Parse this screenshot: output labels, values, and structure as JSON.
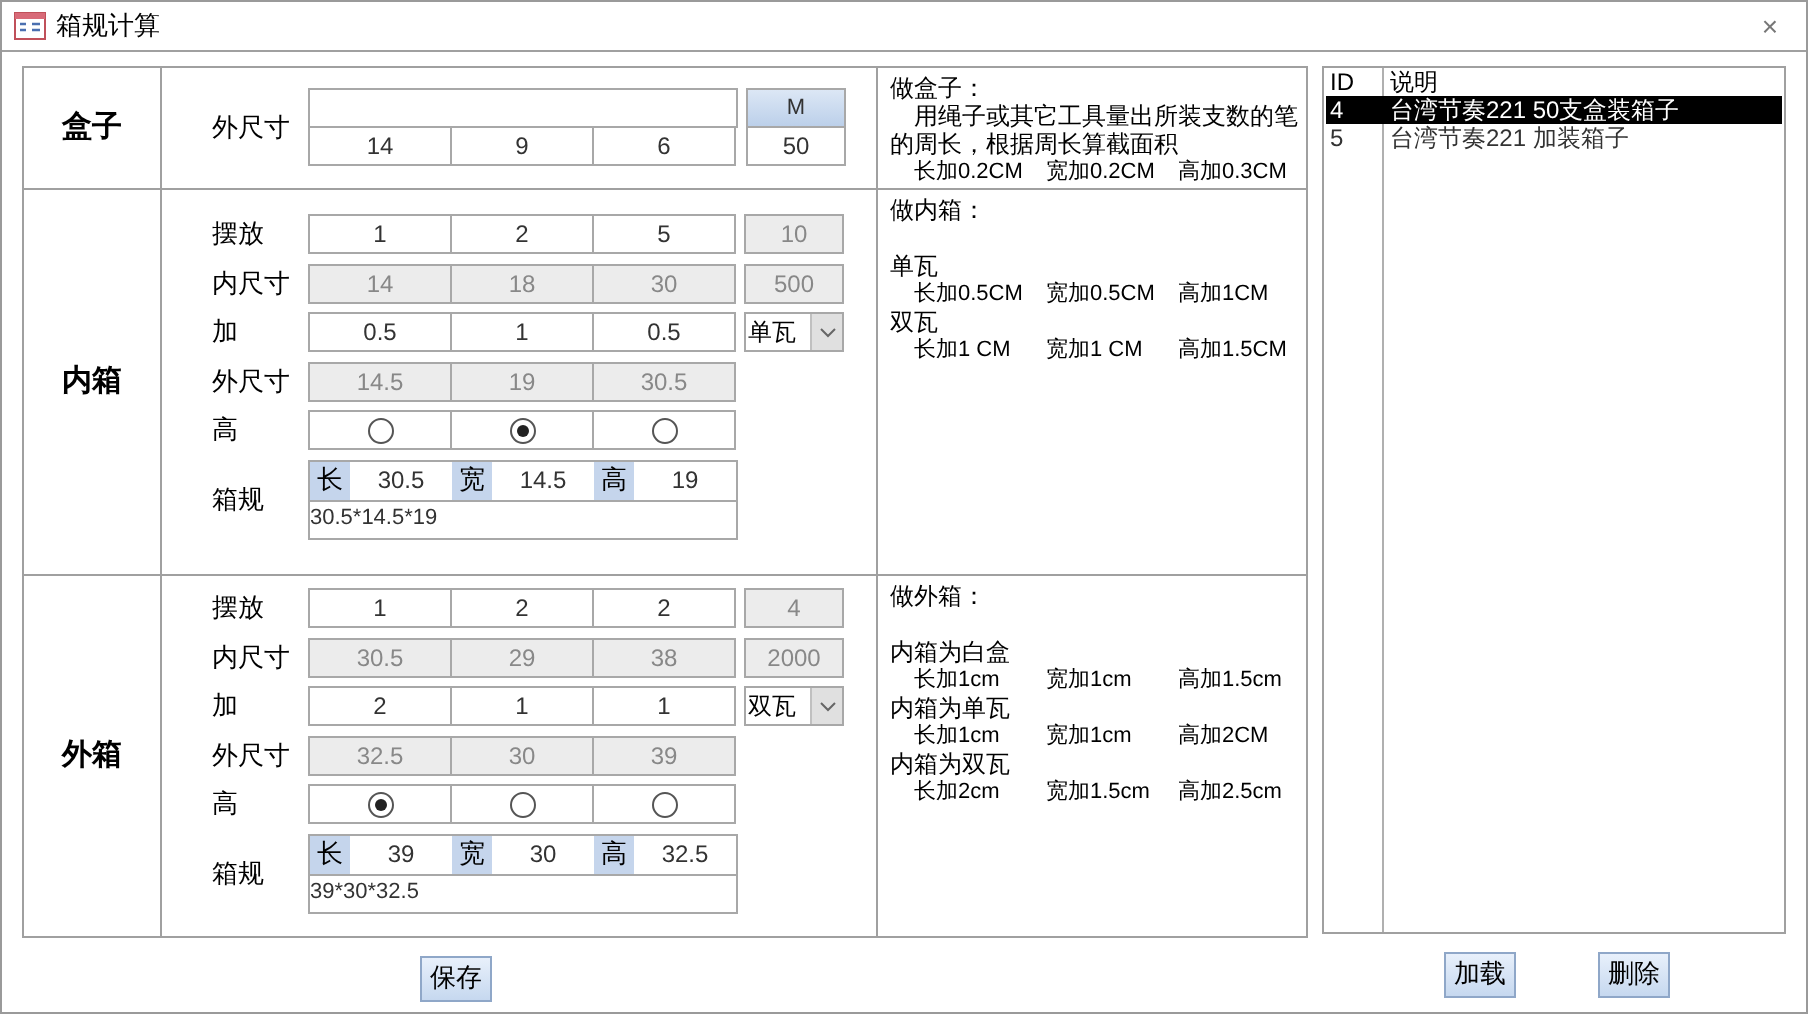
{
  "window": {
    "title": "箱规计算",
    "close": "×"
  },
  "sections": [
    {
      "label": "盒子",
      "rows": [
        {
          "kind": "box",
          "label": "外尺寸",
          "values": [
            "14",
            "9",
            "6"
          ],
          "unit_header": "M",
          "unit_value": "50"
        }
      ],
      "notes": [
        {
          "kind": "title",
          "text": "做盒子："
        },
        {
          "kind": "para",
          "text": "用绳子或其它工具量出所装支数的笔的周长，根据周长算截面积"
        },
        {
          "kind": "items",
          "items": [
            "长加0.2CM",
            "宽加0.2CM",
            "高加0.3CM"
          ]
        }
      ]
    },
    {
      "label": "内箱",
      "rows": [
        {
          "kind": "values",
          "label": "摆放",
          "values": [
            "1",
            "2",
            "5"
          ],
          "disabled": false,
          "total": {
            "value": "10",
            "disabled": true
          }
        },
        {
          "kind": "values",
          "label": "内尺寸",
          "values": [
            "14",
            "18",
            "30"
          ],
          "disabled": true,
          "total": {
            "value": "500",
            "disabled": true
          }
        },
        {
          "kind": "values",
          "label": "加",
          "values": [
            "0.5",
            "1",
            "0.5"
          ],
          "disabled": false,
          "select": "单瓦"
        },
        {
          "kind": "values",
          "label": "外尺寸",
          "values": [
            "14.5",
            "19",
            "30.5"
          ],
          "disabled": true
        },
        {
          "kind": "radio",
          "label": "高",
          "options": [
            {
              "selected": false
            },
            {
              "selected": true
            },
            {
              "selected": false
            }
          ]
        },
        {
          "kind": "spec",
          "label": "箱规",
          "parts": [
            {
              "label": "长",
              "value": "30.5"
            },
            {
              "label": "宽",
              "value": "14.5"
            },
            {
              "label": "高",
              "value": "19"
            }
          ],
          "summary": "30.5*14.5*19"
        }
      ],
      "notes": [
        {
          "kind": "title",
          "text": "做内箱："
        },
        {
          "kind": "gap"
        },
        {
          "kind": "heading",
          "text": "单瓦"
        },
        {
          "kind": "items",
          "items": [
            "长加0.5CM",
            "宽加0.5CM",
            "高加1CM"
          ]
        },
        {
          "kind": "heading",
          "text": "双瓦"
        },
        {
          "kind": "items",
          "items": [
            "长加1 CM",
            "宽加1 CM",
            "高加1.5CM"
          ]
        }
      ]
    },
    {
      "label": "外箱",
      "rows": [
        {
          "kind": "values",
          "label": "摆放",
          "values": [
            "1",
            "2",
            "2"
          ],
          "disabled": false,
          "total": {
            "value": "4",
            "disabled": true
          }
        },
        {
          "kind": "values",
          "label": "内尺寸",
          "values": [
            "30.5",
            "29",
            "38"
          ],
          "disabled": true,
          "total": {
            "value": "2000",
            "disabled": true
          }
        },
        {
          "kind": "values",
          "label": "加",
          "values": [
            "2",
            "1",
            "1"
          ],
          "disabled": false,
          "select": "双瓦"
        },
        {
          "kind": "values",
          "label": "外尺寸",
          "values": [
            "32.5",
            "30",
            "39"
          ],
          "disabled": true
        },
        {
          "kind": "radio",
          "label": "高",
          "options": [
            {
              "selected": true
            },
            {
              "selected": false
            },
            {
              "selected": false
            }
          ]
        },
        {
          "kind": "spec",
          "label": "箱规",
          "parts": [
            {
              "label": "长",
              "value": "39"
            },
            {
              "label": "宽",
              "value": "30"
            },
            {
              "label": "高",
              "value": "32.5"
            }
          ],
          "summary": "39*30*32.5"
        }
      ],
      "notes": [
        {
          "kind": "title",
          "text": "做外箱："
        },
        {
          "kind": "gap"
        },
        {
          "kind": "heading",
          "text": "内箱为白盒"
        },
        {
          "kind": "items",
          "items": [
            "长加1cm",
            "宽加1cm",
            "高加1.5cm"
          ]
        },
        {
          "kind": "heading",
          "text": "内箱为单瓦"
        },
        {
          "kind": "items",
          "items": [
            "长加1cm",
            "宽加1cm",
            "高加2CM"
          ]
        },
        {
          "kind": "heading",
          "text": "内箱为双瓦"
        },
        {
          "kind": "items",
          "items": [
            "长加2cm",
            "宽加1.5cm",
            "高加2.5cm"
          ]
        }
      ]
    }
  ],
  "save_button": "保存",
  "list": {
    "columns": [
      "ID",
      "说明"
    ],
    "rows": [
      {
        "id": "4",
        "description": "台湾节奏221 50支盒装箱子",
        "selected": true
      },
      {
        "id": "5",
        "description": "台湾节奏221 加装箱子",
        "selected": false
      }
    ]
  },
  "load_button": "加载",
  "delete_button": "删除"
}
